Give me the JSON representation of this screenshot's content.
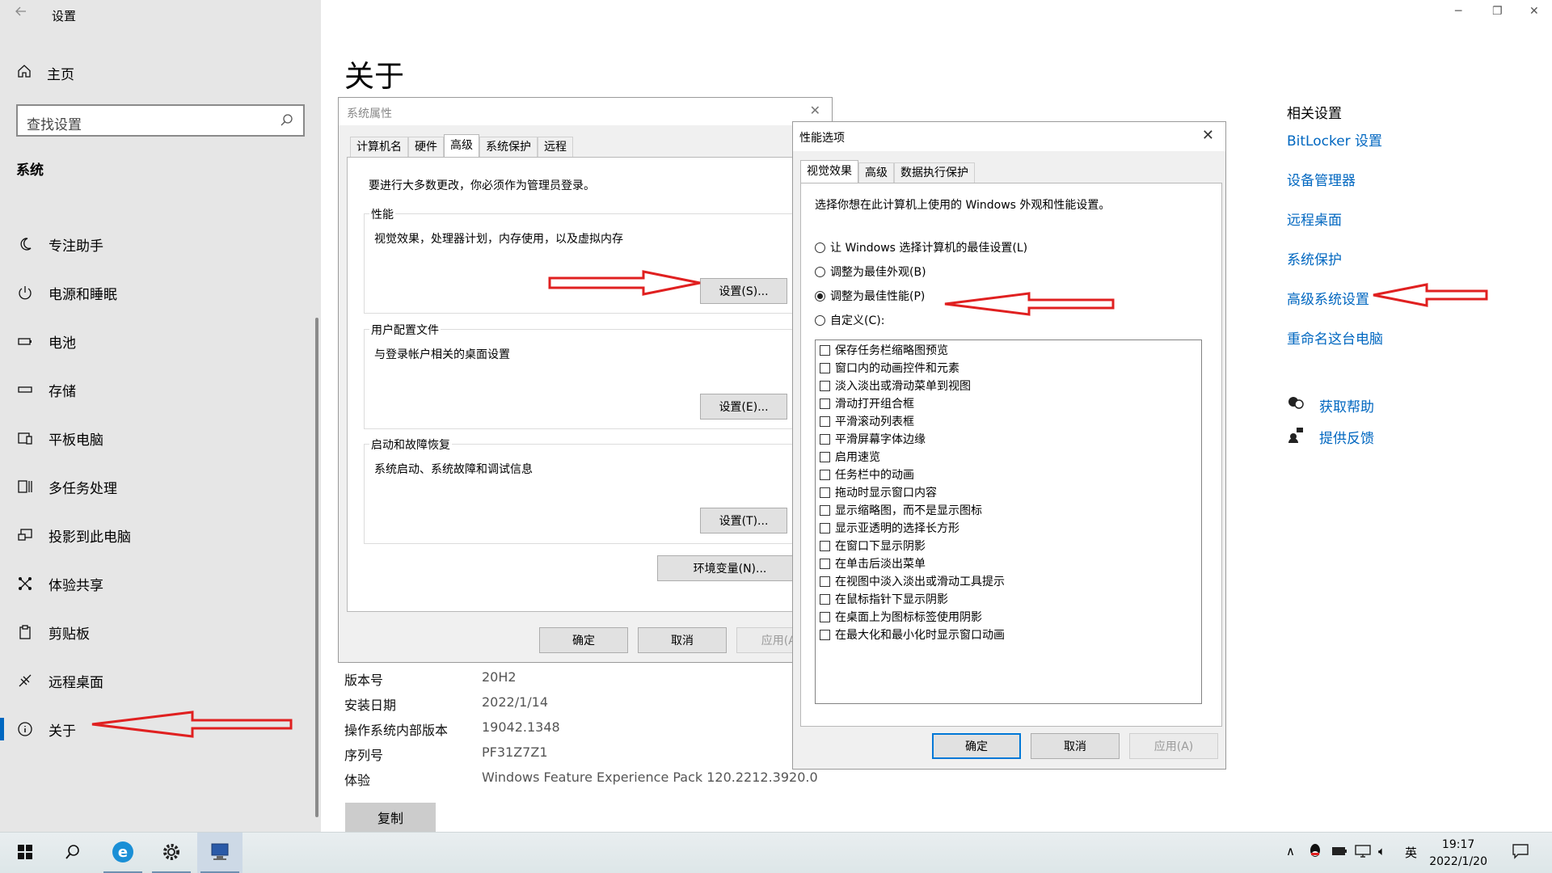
{
  "settings": {
    "app_title": "设置",
    "home_label": "主页",
    "search_placeholder": "查找设置",
    "section_title": "系统",
    "nav_items": [
      {
        "label": "专注助手",
        "icon": "moon-icon"
      },
      {
        "label": "电源和睡眠",
        "icon": "power-icon"
      },
      {
        "label": "电池",
        "icon": "battery-icon"
      },
      {
        "label": "存储",
        "icon": "storage-icon"
      },
      {
        "label": "平板电脑",
        "icon": "tablet-icon"
      },
      {
        "label": "多任务处理",
        "icon": "multitask-icon"
      },
      {
        "label": "投影到此电脑",
        "icon": "project-icon"
      },
      {
        "label": "体验共享",
        "icon": "share-icon"
      },
      {
        "label": "剪贴板",
        "icon": "clipboard-icon"
      },
      {
        "label": "远程桌面",
        "icon": "remote-icon"
      },
      {
        "label": "关于",
        "icon": "info-icon",
        "active": true
      }
    ],
    "page_title": "关于",
    "specs": [
      {
        "key": "版本号",
        "value": "20H2"
      },
      {
        "key": "安装日期",
        "value": "2022/1/14"
      },
      {
        "key": "操作系统内部版本",
        "value": "19042.1348"
      },
      {
        "key": "序列号",
        "value": "PF31Z7Z1"
      },
      {
        "key": "体验",
        "value": "Windows Feature Experience Pack 120.2212.3920.0"
      }
    ],
    "copy_label": "复制",
    "related_title": "相关设置",
    "related_links": [
      "BitLocker 设置",
      "设备管理器",
      "远程桌面",
      "系统保护",
      "高级系统设置",
      "重命名这台电脑"
    ],
    "help_links": [
      "获取帮助",
      "提供反馈"
    ]
  },
  "sysprops": {
    "title": "系统属性",
    "tabs": [
      "计算机名",
      "硬件",
      "高级",
      "系统保护",
      "远程"
    ],
    "admin_note": "要进行大多数更改，你必须作为管理员登录。",
    "perf_title": "性能",
    "perf_desc": "视觉效果，处理器计划，内存使用，以及虚拟内存",
    "perf_btn": "设置(S)...",
    "profile_title": "用户配置文件",
    "profile_desc": "与登录帐户相关的桌面设置",
    "profile_btn": "设置(E)...",
    "startup_title": "启动和故障恢复",
    "startup_desc": "系统启动、系统故障和调试信息",
    "startup_btn": "设置(T)...",
    "env_btn": "环境变量(N)...",
    "ok": "确定",
    "cancel": "取消",
    "apply": "应用(A)"
  },
  "perf": {
    "title": "性能选项",
    "tabs": [
      "视觉效果",
      "高级",
      "数据执行保护"
    ],
    "intro": "选择你想在此计算机上使用的 Windows 外观和性能设置。",
    "radios": [
      {
        "label": "让 Windows 选择计算机的最佳设置(L)",
        "checked": false
      },
      {
        "label": "调整为最佳外观(B)",
        "checked": false
      },
      {
        "label": "调整为最佳性能(P)",
        "checked": true
      },
      {
        "label": "自定义(C):",
        "checked": false
      }
    ],
    "checkboxes": [
      "保存任务栏缩略图预览",
      "窗口内的动画控件和元素",
      "淡入淡出或滑动菜单到视图",
      "滑动打开组合框",
      "平滑滚动列表框",
      "平滑屏幕字体边缘",
      "启用速览",
      "任务栏中的动画",
      "拖动时显示窗口内容",
      "显示缩略图，而不是显示图标",
      "显示亚透明的选择长方形",
      "在窗口下显示阴影",
      "在单击后淡出菜单",
      "在视图中淡入淡出或滑动工具提示",
      "在鼠标指针下显示阴影",
      "在桌面上为图标标签使用阴影",
      "在最大化和最小化时显示窗口动画"
    ],
    "ok": "确定",
    "cancel": "取消",
    "apply": "应用(A)"
  },
  "taskbar": {
    "ime": "英",
    "time": "19:17",
    "date": "2022/1/20"
  },
  "colors": {
    "accent": "#0067c0",
    "arrow": "#e02020"
  }
}
